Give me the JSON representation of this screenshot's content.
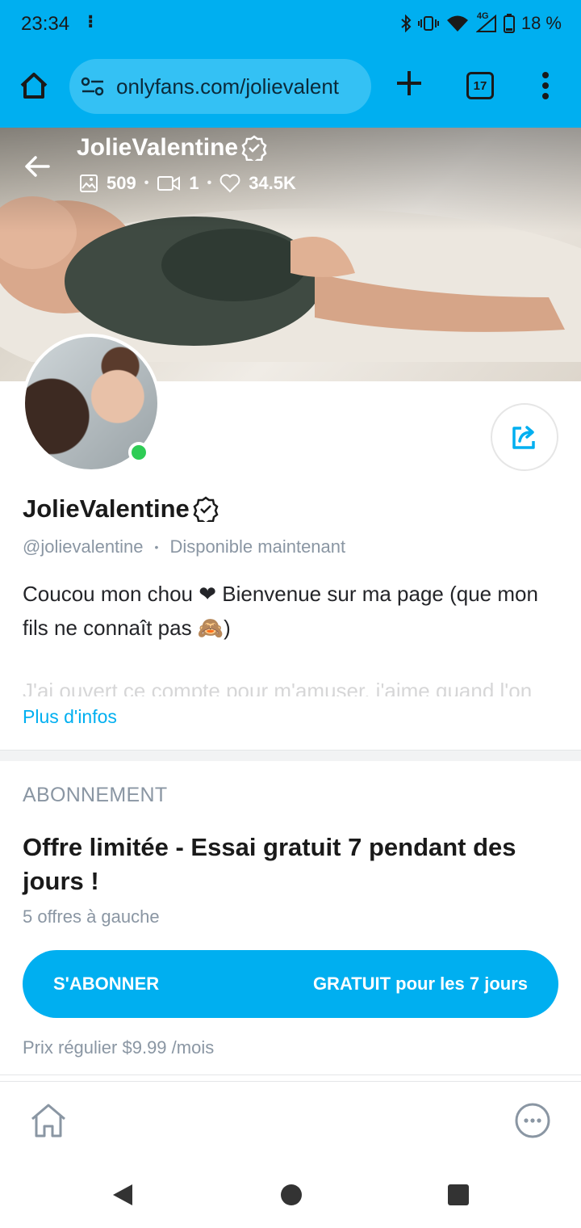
{
  "status_bar": {
    "time": "23:34",
    "network": "4G",
    "battery": "18 %"
  },
  "browser": {
    "url": "onlyfans.com/jolievalent",
    "tab_count": "17"
  },
  "cover": {
    "name": "JolieValentine",
    "photos_count": "509",
    "videos_count": "1",
    "likes_count": "34.5K"
  },
  "profile": {
    "name": "JolieValentine",
    "handle": "@jolievalentine",
    "separator": "•",
    "availability": "Disponible maintenant",
    "bio": "Coucou mon chou ❤ Bienvenue sur ma page (que mon fils ne connaît pas 🙈)",
    "bio_faded": "J'ai ouvert ce compte pour m'amuser, j'aime quand l'on",
    "more_info": "Plus d'infos"
  },
  "subscription": {
    "heading": "ABONNEMENT",
    "offer_title": "Offre limitée - Essai gratuit 7 pendant des jours !",
    "offers_left": "5 offres à gauche",
    "button_label": "S'ABONNER",
    "button_price": "GRATUIT pour les 7 jours",
    "regular_price": "Prix régulier $9.99 /mois"
  },
  "colors": {
    "accent": "#00aff0",
    "online": "#2ecc55",
    "muted": "#8a96a3"
  }
}
